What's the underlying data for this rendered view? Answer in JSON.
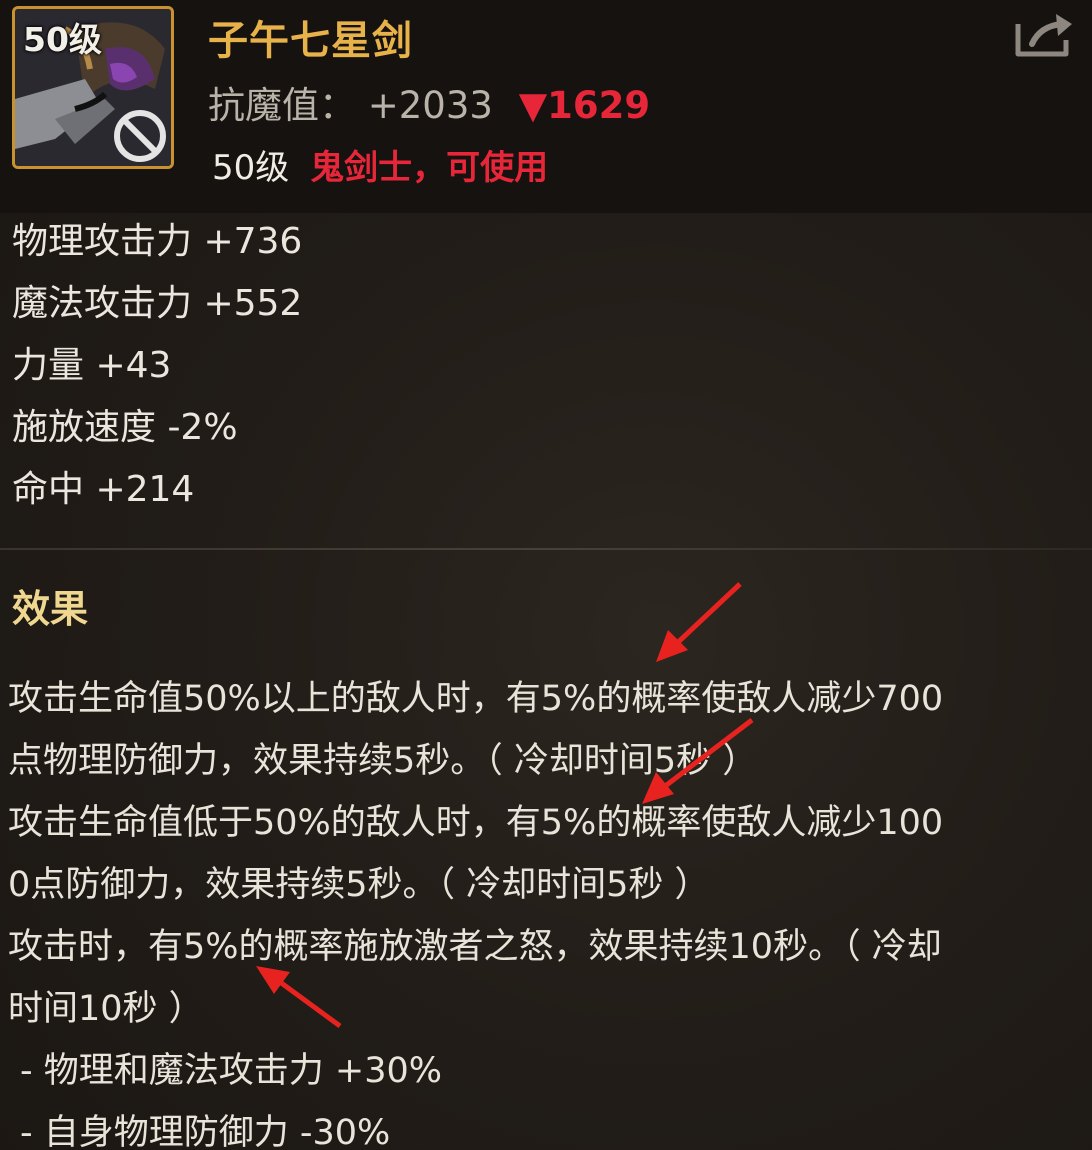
{
  "item": {
    "level_badge": "50级",
    "name": "子午七星剑",
    "stat_label": "抗魔值：",
    "stat_value": "+2033",
    "stat_compare": "▼1629",
    "requirement_level": "50级",
    "requirement_class": "鬼剑士，可使用"
  },
  "stats": [
    "物理攻击力 +736",
    "魔法攻击力 +552",
    "力量 +43",
    "施放速度 -2%",
    "命中 +214"
  ],
  "effect_title": "效果",
  "effects": [
    "攻击生命值50%以上的敌人时，有5%的概率使敌人减少700",
    "点物理防御力，效果持续5秒。（ 冷却时间5秒 ）",
    "攻击生命值低于50%的敌人时，有5%的概率使敌人减少100",
    "0点防御力，效果持续5秒。（ 冷却时间5秒 ）",
    "攻击时，有5%的概率施放激者之怒，效果持续10秒。（ 冷却",
    "时间10秒 ）"
  ],
  "sub_effects": [
    "- 物理和魔法攻击力 +30%",
    "- 自身物理防御力 -30%"
  ],
  "colors": {
    "item_name": "#e8b24a",
    "decrease": "#e8263a",
    "class_requirement": "#e8263a",
    "icon_border": "#c9922e",
    "annotation_arrow": "#e8231f"
  },
  "icons": {
    "item": "sword-item-icon",
    "unusable": "prohibited-icon",
    "share": "share-icon"
  }
}
